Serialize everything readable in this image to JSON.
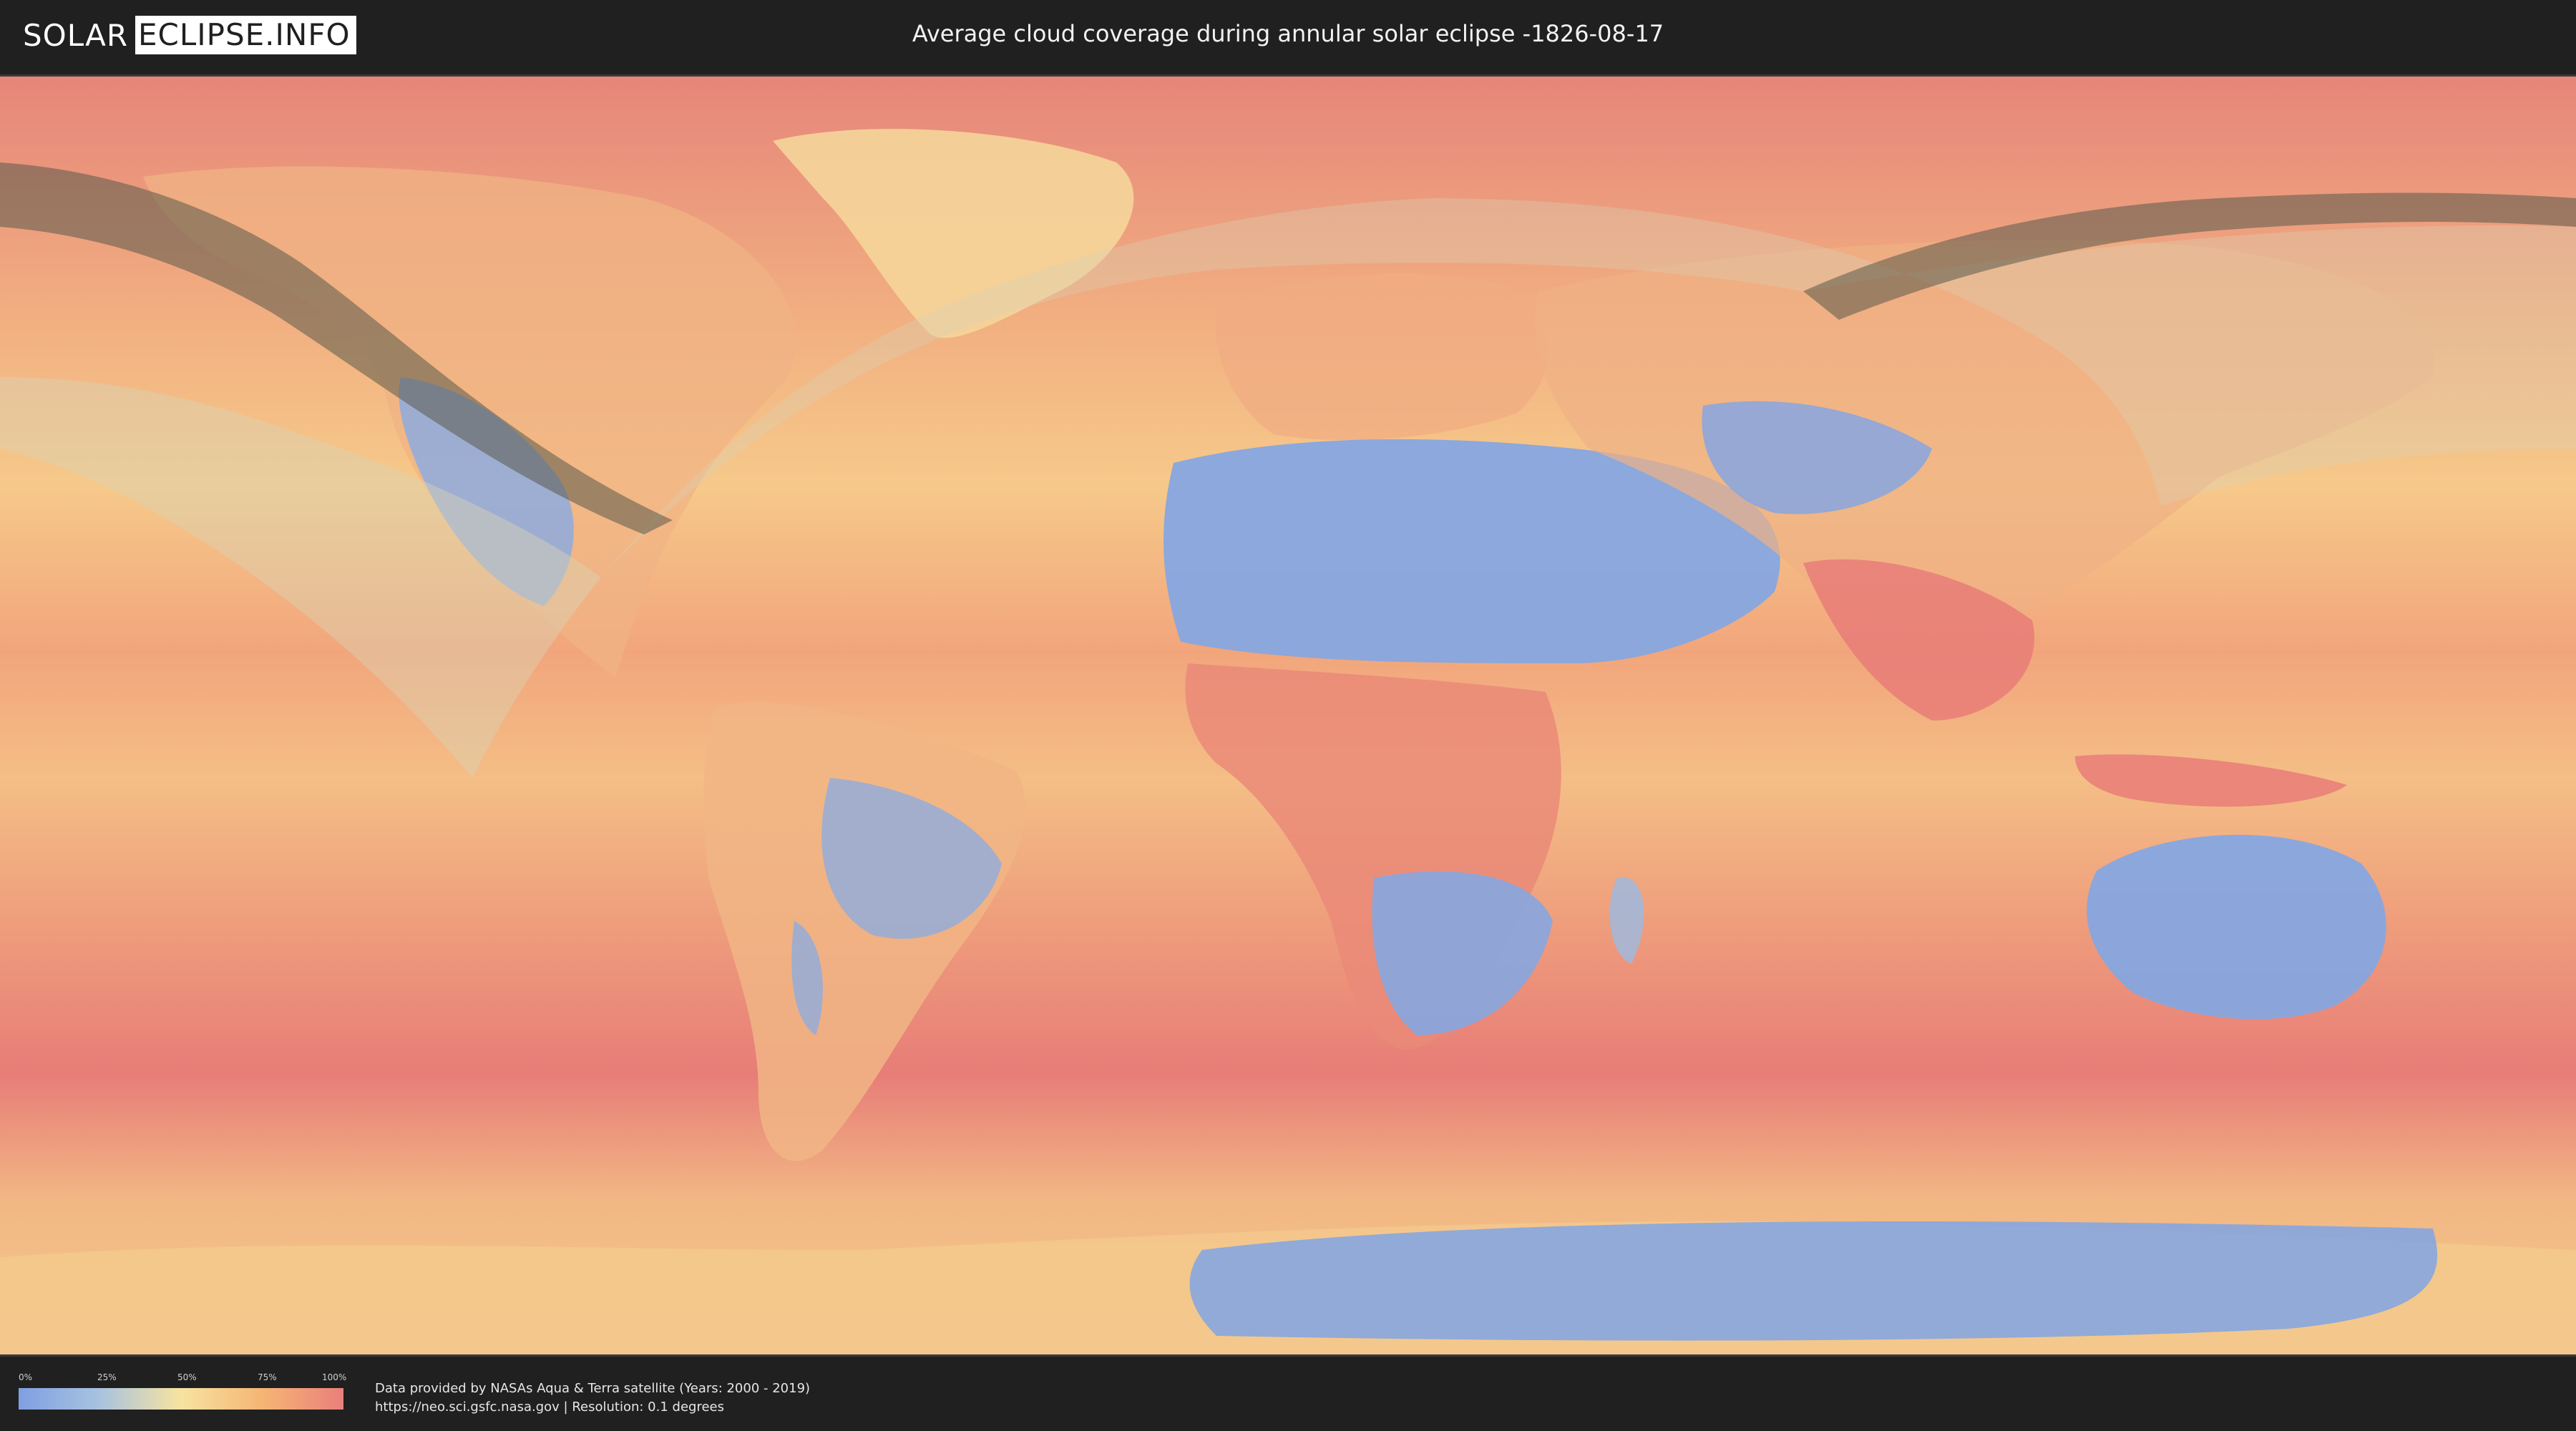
{
  "logo": {
    "left": "SOLAR",
    "right": "ECLIPSE.INFO"
  },
  "title": "Average cloud coverage during annular solar eclipse -1826-08-17",
  "legend": {
    "ticks": [
      "0%",
      "25%",
      "50%",
      "75%",
      "100%"
    ],
    "colors": [
      "#7f9fe3",
      "#a8c3df",
      "#f7e3a0",
      "#f6b574",
      "#ea7f7c"
    ]
  },
  "credits": {
    "line1": "Data provided by NASAs Aqua & Terra satellite (Years: 2000 - 2019)",
    "line2": "https://neo.sci.gsfc.nasa.gov | Resolution: 0.1 degrees"
  },
  "map": {
    "ocean_color": "#f0a57a",
    "cloudy_color": "#e97c78",
    "clear_color": "#7f9fe3",
    "eclipse_path_color": "#5a5a4a"
  }
}
